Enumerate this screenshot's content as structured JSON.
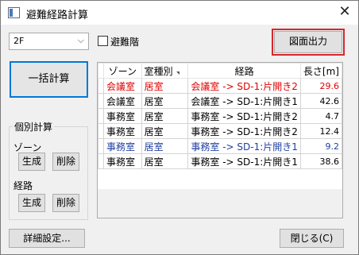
{
  "window": {
    "title": "避難経路計算",
    "close_glyph": "✕"
  },
  "toolbar": {
    "floor": {
      "value": "2F",
      "chevron": "⌵"
    },
    "stair_checkbox": {
      "label": "避難階",
      "checked": false
    },
    "export_label": "図面出力"
  },
  "left_panel": {
    "batch_label": "一括計算",
    "individual": {
      "title": "個別計算",
      "zone_label": "ゾーン",
      "route_label": "経路",
      "generate_label": "生成",
      "delete_label": "削除"
    }
  },
  "table": {
    "headers": {
      "zone": "ゾーン",
      "room_type": "室種別",
      "route": "経路",
      "length": "長さ[m]"
    },
    "rows": [
      {
        "zone": "会議室",
        "room_type": "居室",
        "route": "会議室 -> SD-1:片開き2",
        "length": "29.6",
        "color": "#e00000"
      },
      {
        "zone": "会議室",
        "room_type": "居室",
        "route": "会議室 -> SD-1:片開き1",
        "length": "42.6",
        "color": "#000000"
      },
      {
        "zone": "事務室",
        "room_type": "居室",
        "route": "事務室 -> SD-1:片開き2",
        "length": "4.7",
        "color": "#000000"
      },
      {
        "zone": "事務室",
        "room_type": "居室",
        "route": "事務室 -> SD-1:片開き2",
        "length": "12.4",
        "color": "#000000"
      },
      {
        "zone": "事務室",
        "room_type": "居室",
        "route": "事務室 -> SD-1:片開き1",
        "length": "9.2",
        "color": "#1f3fa0"
      },
      {
        "zone": "事務室",
        "room_type": "居室",
        "route": "事務室 -> SD-1:片開き1",
        "length": "38.6",
        "color": "#000000"
      }
    ]
  },
  "footer": {
    "detail_label": "詳細設定...",
    "close_label": "閉じる(C)"
  }
}
